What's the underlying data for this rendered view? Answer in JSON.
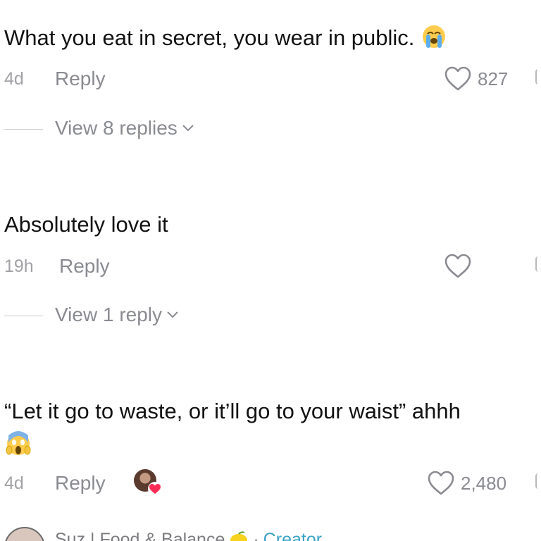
{
  "comments": [
    {
      "text": "What you eat in secret, you wear in public.",
      "emoji": "loudly-crying-face",
      "time": "4d",
      "reply_label": "Reply",
      "likes": "827",
      "view_replies": "View 8 replies"
    },
    {
      "text": "Absolutely love it",
      "time": "19h",
      "reply_label": "Reply",
      "likes": "",
      "view_replies": "View 1 reply"
    },
    {
      "text": "“Let it go to waste, or it’ll go to your waist” ahhh",
      "emoji": "face-screaming-in-fear",
      "time": "4d",
      "reply_label": "Reply",
      "likes": "2,480",
      "liked_by_creator": true
    }
  ],
  "reply_preview": {
    "author": "Suz | Food & Balance",
    "author_emoji": "lemon",
    "separator": "·",
    "badge": "Creator"
  },
  "colors": {
    "text": "#111111",
    "muted": "#8a8b91",
    "heart_badge": "#fe2c55",
    "creator": "#3aa1c8"
  }
}
